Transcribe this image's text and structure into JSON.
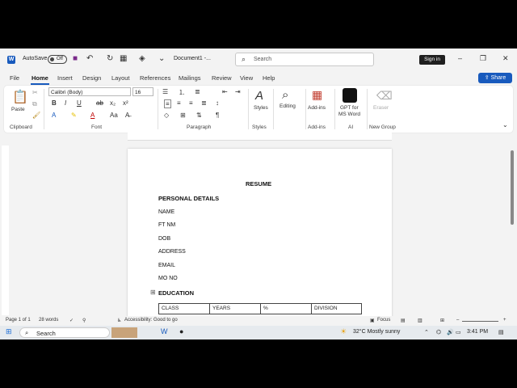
{
  "titlebar": {
    "autosave_label": "AutoSave",
    "autosave_state": "Off",
    "doc_title": "Document1 -...",
    "search_placeholder": "Search",
    "signin_label": "Sign in",
    "minimize": "–",
    "restore": "❐",
    "close": "✕"
  },
  "menu": {
    "tabs": [
      "File",
      "Home",
      "Insert",
      "Design",
      "Layout",
      "References",
      "Mailings",
      "Review",
      "View",
      "Help"
    ],
    "share_label": "Share"
  },
  "ribbon": {
    "clipboard": {
      "paste": "Paste",
      "label": "Clipboard"
    },
    "font": {
      "name": "Calibri (Body)",
      "size": "16",
      "label": "Font"
    },
    "paragraph": {
      "label": "Paragraph"
    },
    "styles": {
      "button": "Styles",
      "label": "Styles"
    },
    "editing": {
      "button": "Editing"
    },
    "addins": {
      "button": "Add-ins",
      "label": "Add-ins"
    },
    "ai": {
      "button_line1": "GPT for",
      "button_line2": "MS Word",
      "label": "AI"
    },
    "newgroup": {
      "button": "Eraser",
      "label": "New Group"
    }
  },
  "document": {
    "title": "RESUME",
    "personal_heading": "PERSONAL DETAILS",
    "fields": [
      "NAME",
      "FT NM",
      "DOB",
      "ADDRESS",
      "EMAIL",
      "MO NO"
    ],
    "education_heading": "EDUCATION",
    "table_headers": [
      "CLASS",
      "YEARS",
      "%",
      "DIVISION"
    ]
  },
  "status": {
    "page": "Page 1 of 1",
    "words": "28 words",
    "accessibility": "Accessibility: Good to go",
    "focus": "Focus"
  },
  "taskbar": {
    "search": "Search",
    "weather": "32°C  Mostly sunny",
    "time": "3:41 PM"
  },
  "colors": {
    "accent": "#185abd"
  }
}
